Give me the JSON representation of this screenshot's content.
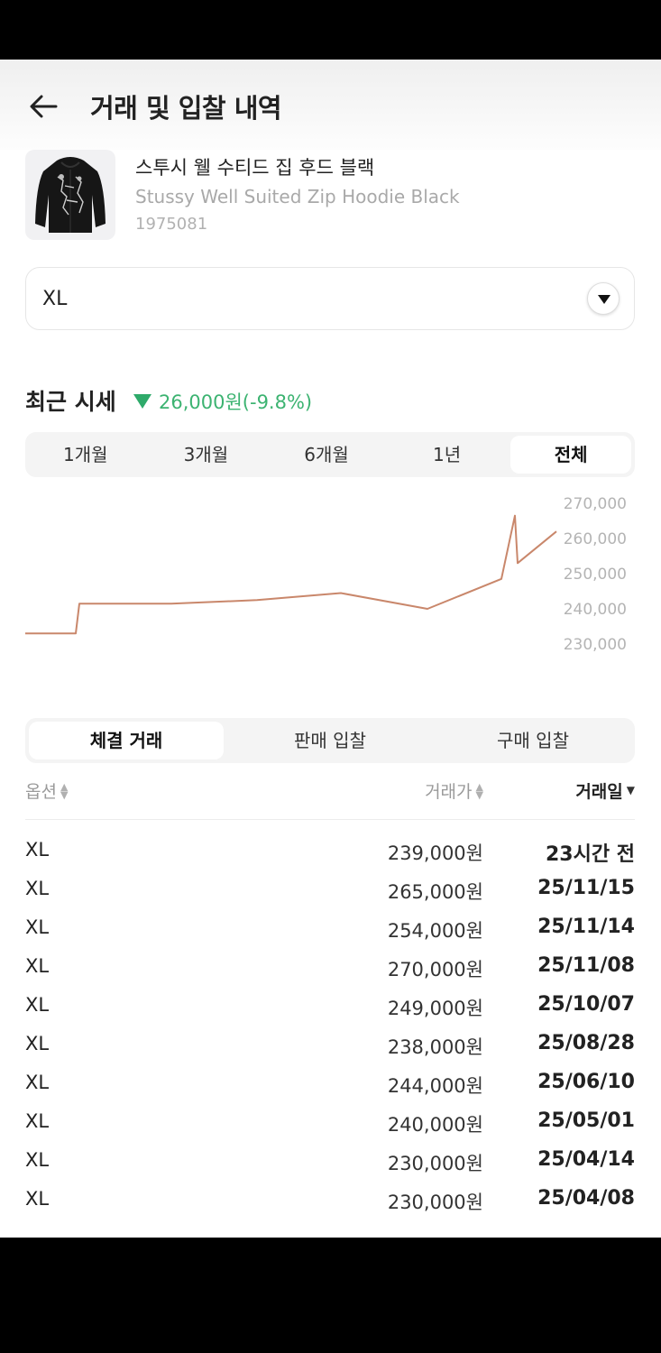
{
  "header": {
    "title": "거래 및 입찰 내역",
    "back_icon": "arrow-left-icon"
  },
  "product": {
    "name_ko": "스투시 웰 수티드 집 후드 블랙",
    "name_en": "Stussy Well Suited Zip Hoodie Black",
    "model_code": "1975081",
    "image": "black-hoodie-thumbnail"
  },
  "size_select": {
    "value": "XL",
    "icon": "chevron-down-icon"
  },
  "market": {
    "title": "최근 시세",
    "change": "26,000원(-9.8%)",
    "change_direction": "down",
    "change_color": "#2eaa6a"
  },
  "periods": [
    {
      "label": "1개월",
      "active": false
    },
    {
      "label": "3개월",
      "active": false
    },
    {
      "label": "6개월",
      "active": false
    },
    {
      "label": "1년",
      "active": false
    },
    {
      "label": "전체",
      "active": true
    }
  ],
  "chart_data": {
    "type": "line",
    "y_tick_labels": [
      "270,000",
      "260,000",
      "250,000",
      "240,000",
      "230,000"
    ],
    "ylim": [
      230000,
      270000
    ],
    "line_color": "#c9876b",
    "grid": false,
    "series": [
      {
        "values": [
          233000,
          233000,
          241500,
          241500,
          242500,
          243500,
          244500,
          240000,
          248500,
          266500,
          253000,
          262000
        ]
      }
    ]
  },
  "trade_tabs": [
    {
      "label": "체결 거래",
      "active": true
    },
    {
      "label": "판매 입찰",
      "active": false
    },
    {
      "label": "구매 입찰",
      "active": false
    }
  ],
  "table": {
    "headers": {
      "option": "옵션",
      "price": "거래가",
      "date": "거래일"
    },
    "rows": [
      {
        "option": "XL",
        "price": "239,000원",
        "date": "23시간 전"
      },
      {
        "option": "XL",
        "price": "265,000원",
        "date": "25/11/15"
      },
      {
        "option": "XL",
        "price": "254,000원",
        "date": "25/11/14"
      },
      {
        "option": "XL",
        "price": "270,000원",
        "date": "25/11/08"
      },
      {
        "option": "XL",
        "price": "249,000원",
        "date": "25/10/07"
      },
      {
        "option": "XL",
        "price": "238,000원",
        "date": "25/08/28"
      },
      {
        "option": "XL",
        "price": "244,000원",
        "date": "25/06/10"
      },
      {
        "option": "XL",
        "price": "240,000원",
        "date": "25/05/01"
      },
      {
        "option": "XL",
        "price": "230,000원",
        "date": "25/04/14"
      },
      {
        "option": "XL",
        "price": "230,000원",
        "date": "25/04/08"
      }
    ]
  }
}
